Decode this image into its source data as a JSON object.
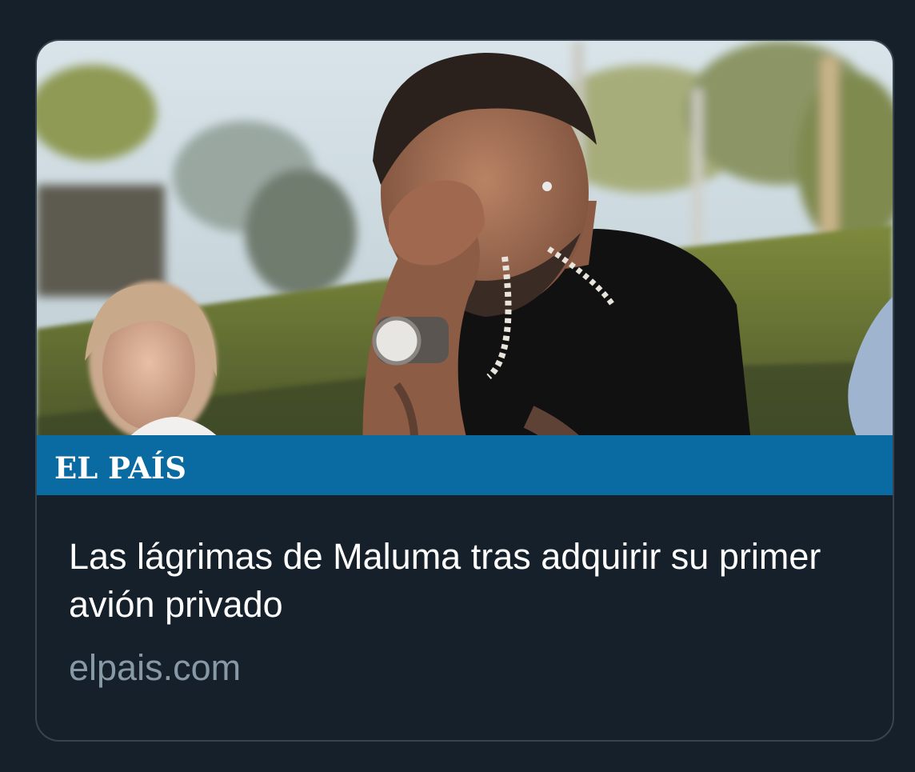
{
  "link_card": {
    "headline": "Las lágrimas de Maluma tras adquirir su primer avión privado",
    "domain": "elpais.com",
    "brand_logo_text": "EL PAÍS",
    "brand_bar_color": "#0a6aa2"
  },
  "theme": {
    "background": "#15202b",
    "card_border": "#38444d",
    "headline_color": "#ffffff",
    "domain_color": "#8899a6"
  }
}
